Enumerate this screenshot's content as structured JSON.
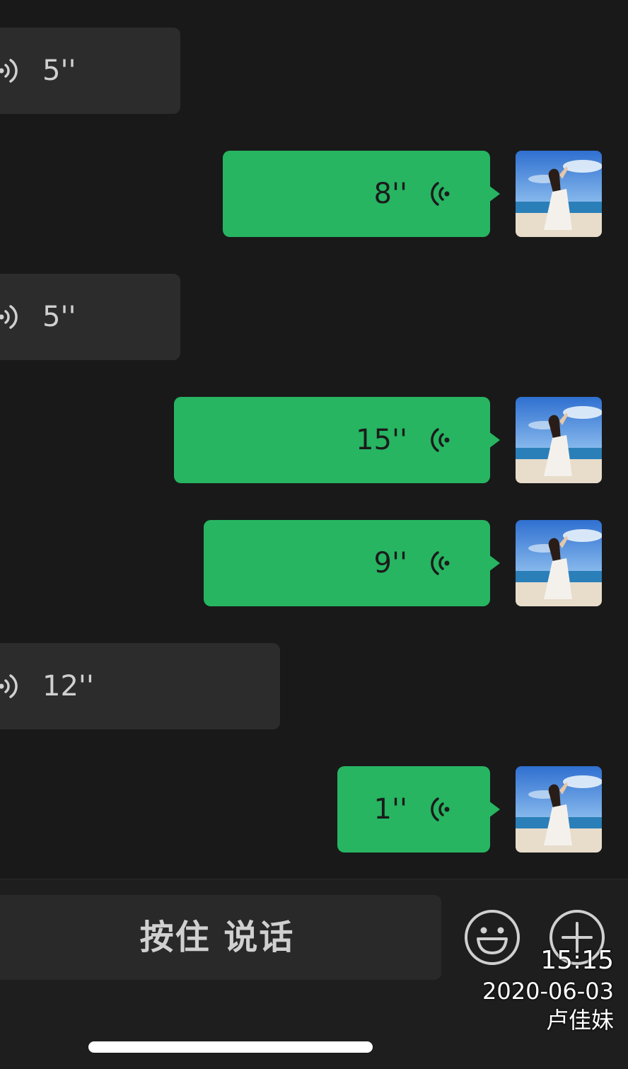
{
  "messages": [
    {
      "direction": "incoming",
      "duration": "5''"
    },
    {
      "direction": "outgoing",
      "duration": "8''"
    },
    {
      "direction": "incoming",
      "duration": "5''"
    },
    {
      "direction": "outgoing",
      "duration": "15''"
    },
    {
      "direction": "outgoing",
      "duration": "9''"
    },
    {
      "direction": "incoming",
      "duration": "12''"
    },
    {
      "direction": "outgoing",
      "duration": "1''"
    }
  ],
  "icons": {
    "incoming_voice": "voice-wave-right-icon",
    "outgoing_voice": "voice-wave-left-icon",
    "emoji": "emoji-smile-icon",
    "plus": "plus-circle-icon"
  },
  "input_bar": {
    "hold_to_talk_label": "按住 说话"
  },
  "watermark": {
    "time": "15:15",
    "date": "2020-06-03",
    "name": "卢佳妹"
  },
  "colors": {
    "background": "#191919",
    "incoming_bubble": "#2c2c2c",
    "outgoing_bubble": "#27b562",
    "input_bar": "#1e1e1e",
    "hold_button": "#292929"
  }
}
